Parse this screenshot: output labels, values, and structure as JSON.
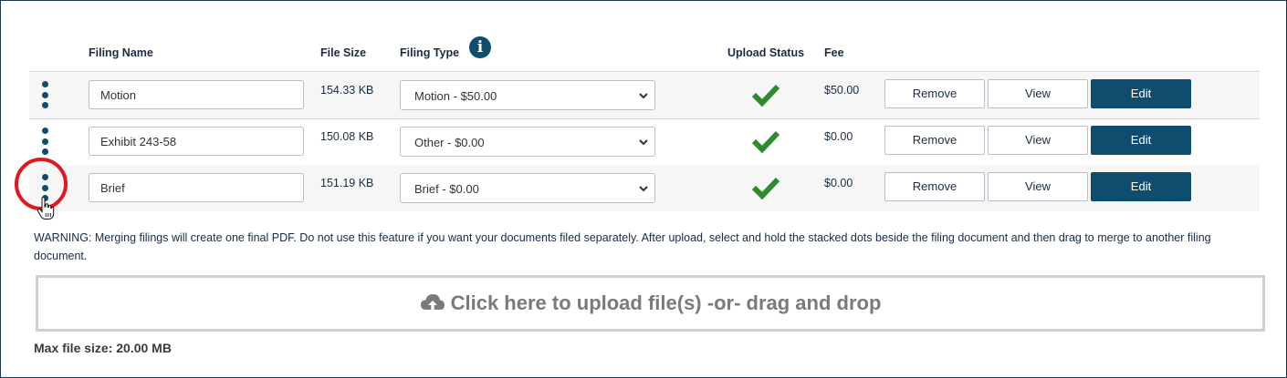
{
  "headers": {
    "filing_name": "Filing Name",
    "file_size": "File Size",
    "filing_type": "Filing Type",
    "upload_status": "Upload Status",
    "fee": "Fee"
  },
  "icons": {
    "info": "info-circle-icon",
    "drag": "vertical-dots-drag-icon",
    "status": "checkmark-icon",
    "chevron": "chevron-down-icon",
    "upload": "cloud-upload-icon",
    "cursor": "hand-pointer-cursor-icon"
  },
  "colors": {
    "accent": "#0e4d6e",
    "success": "#2e8b2e",
    "highlight": "#e0191e"
  },
  "rows": [
    {
      "name": "Motion",
      "size": "154.33 KB",
      "type": "Motion - $50.00",
      "fee": "$50.00",
      "status": "uploaded"
    },
    {
      "name": "Exhibit 243-58",
      "size": "150.08 KB",
      "type": "Other - $0.00",
      "fee": "$0.00",
      "status": "uploaded"
    },
    {
      "name": "Brief",
      "size": "151.19 KB",
      "type": "Brief - $0.00",
      "fee": "$0.00",
      "status": "uploaded"
    }
  ],
  "buttons": {
    "remove": "Remove",
    "view": "View",
    "edit": "Edit"
  },
  "warning": "WARNING: Merging filings will create one final PDF. Do not use this feature if you want your documents filed separately. After upload, select and hold the stacked dots beside the filing document and then drag to merge to another filing document.",
  "dropzone": {
    "label": "Click here to upload file(s) -or- drag and drop"
  },
  "max_file_size": "Max file size: 20.00 MB"
}
